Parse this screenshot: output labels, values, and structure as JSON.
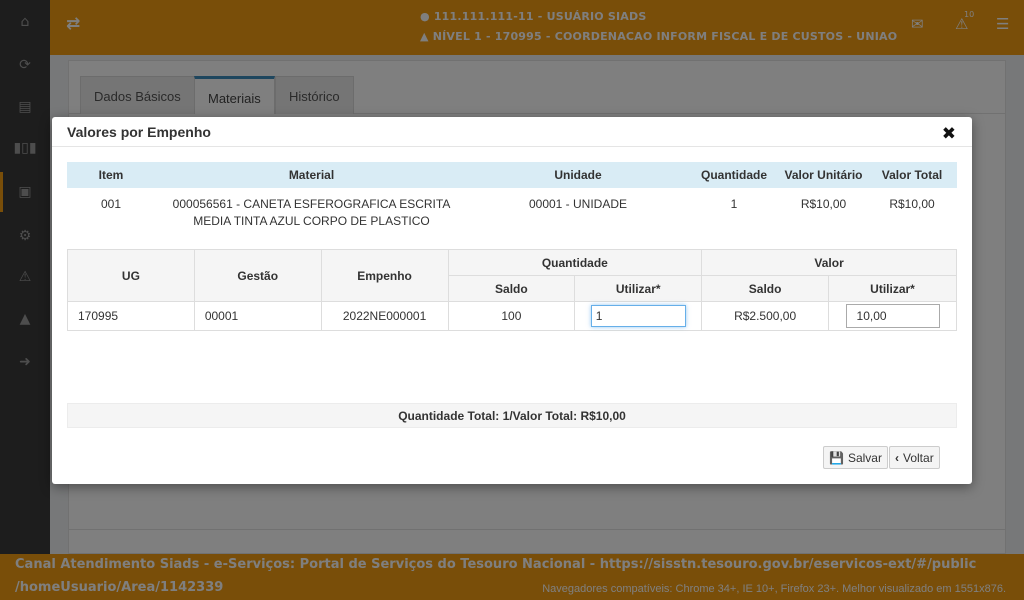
{
  "header": {
    "user": "111.111.111-11 - USUÁRIO SIADS",
    "level": "NÍVEL 1 - 170995 - COORDENACAO INFORM FISCAL E DE CUSTOS - UNIAO",
    "notification_count": "10"
  },
  "tabs": [
    {
      "label": "Dados Básicos"
    },
    {
      "label": "Materiais"
    },
    {
      "label": "Histórico"
    }
  ],
  "modal": {
    "title": "Valores por Empenho",
    "item_table": {
      "headers": [
        "Item",
        "Material",
        "Unidade",
        "Quantidade",
        "Valor Unitário",
        "Valor Total"
      ],
      "row": {
        "item": "001",
        "material_line1": "000056561 - CANETA ESFEROGRAFICA ESCRITA",
        "material_line2": "MEDIA TINTA AZUL CORPO DE PLASTICO",
        "unidade": "00001 - UNIDADE",
        "quantidade": "1",
        "valor_unitario": "R$10,00",
        "valor_total": "R$10,00"
      }
    },
    "empenho_table": {
      "headers": {
        "ug": "UG",
        "gestao": "Gestão",
        "empenho": "Empenho",
        "quantidade": "Quantidade",
        "valor": "Valor",
        "saldo": "Saldo",
        "utilizar": "Utilizar*"
      },
      "row": {
        "ug": "170995",
        "gestao": "00001",
        "empenho": "2022NE000001",
        "qtd_saldo": "100",
        "qtd_utilizar": "1",
        "valor_saldo": "R$2.500,00",
        "valor_utilizar": "10,00"
      }
    },
    "totals": {
      "qty_label": "Quantidade Total: 1",
      "separator": "/",
      "value_label": "Valor Total: R$10,00"
    },
    "buttons": {
      "save": "Salvar",
      "back": "Voltar"
    }
  },
  "footer": {
    "line1": "Canal Atendimento Siads - e-Serviços: Portal de Serviços do Tesouro Nacional - https://sisstn.tesouro.gov.br/eservicos-ext/#/public",
    "line2": "/homeUsuario/Area/1142339",
    "browsers": "Navegadores compatíveis: Chrome 34+, IE 10+, Firefox 23+. Melhor visualizado em 1551x876."
  },
  "colors": {
    "accent": "#f39c12",
    "sidebar": "#3a3a3a",
    "table_header": "#d9ecf5",
    "tab_active": "#3c8dbc"
  }
}
